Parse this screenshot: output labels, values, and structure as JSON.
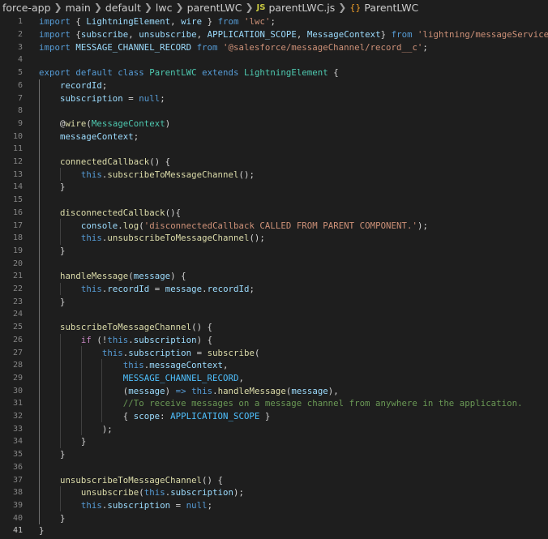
{
  "breadcrumb": {
    "items": [
      "force-app",
      "main",
      "default",
      "lwc",
      "parentLWC",
      "parentLWC.js",
      "ParentLWC"
    ],
    "js_badge": "JS",
    "class_badge": "{}"
  },
  "editor": {
    "active_line": 41,
    "lines": [
      {
        "n": "1",
        "t": [
          [
            "kw",
            "import "
          ],
          [
            "pn",
            "{ "
          ],
          [
            "var",
            "LightningElement"
          ],
          [
            "pn",
            ", "
          ],
          [
            "var",
            "wire"
          ],
          [
            "pn",
            " } "
          ],
          [
            "kw",
            "from "
          ],
          [
            "str",
            "'lwc'"
          ],
          [
            "pn",
            ";"
          ]
        ]
      },
      {
        "n": "2",
        "t": [
          [
            "kw",
            "import "
          ],
          [
            "pn",
            "{"
          ],
          [
            "var",
            "subscribe"
          ],
          [
            "pn",
            ", "
          ],
          [
            "var",
            "unsubscribe"
          ],
          [
            "pn",
            ", "
          ],
          [
            "var",
            "APPLICATION_SCOPE"
          ],
          [
            "pn",
            ", "
          ],
          [
            "var",
            "MessageContext"
          ],
          [
            "pn",
            "} "
          ],
          [
            "kw",
            "from "
          ],
          [
            "str",
            "'lightning/messageService'"
          ],
          [
            "pn",
            ";"
          ]
        ]
      },
      {
        "n": "3",
        "t": [
          [
            "kw",
            "import "
          ],
          [
            "var",
            "MESSAGE_CHANNEL_RECORD"
          ],
          [
            "kw",
            " from "
          ],
          [
            "str",
            "'@salesforce/messageChannel/record__c'"
          ],
          [
            "pn",
            ";"
          ]
        ]
      },
      {
        "n": "4",
        "t": []
      },
      {
        "n": "5",
        "t": [
          [
            "kw",
            "export "
          ],
          [
            "kw",
            "default "
          ],
          [
            "kw",
            "class "
          ],
          [
            "cls-t",
            "ParentLWC "
          ],
          [
            "kw",
            "extends "
          ],
          [
            "cls-t",
            "LightningElement "
          ],
          [
            "pn",
            "{"
          ]
        ]
      },
      {
        "n": "6",
        "t": [
          [
            "pn",
            "    "
          ],
          [
            "var",
            "recordId"
          ],
          [
            "pn",
            ";"
          ]
        ]
      },
      {
        "n": "7",
        "t": [
          [
            "pn",
            "    "
          ],
          [
            "var",
            "subscription"
          ],
          [
            "pn",
            " = "
          ],
          [
            "kw",
            "null"
          ],
          [
            "pn",
            ";"
          ]
        ]
      },
      {
        "n": "8",
        "t": []
      },
      {
        "n": "9",
        "t": [
          [
            "pn",
            "    @"
          ],
          [
            "fn",
            "wire"
          ],
          [
            "pn",
            "("
          ],
          [
            "cls-t",
            "MessageContext"
          ],
          [
            "pn",
            ")"
          ]
        ]
      },
      {
        "n": "10",
        "t": [
          [
            "pn",
            "    "
          ],
          [
            "var",
            "messageContext"
          ],
          [
            "pn",
            ";"
          ]
        ]
      },
      {
        "n": "11",
        "t": []
      },
      {
        "n": "12",
        "t": [
          [
            "pn",
            "    "
          ],
          [
            "fn",
            "connectedCallback"
          ],
          [
            "pn",
            "() {"
          ]
        ]
      },
      {
        "n": "13",
        "t": [
          [
            "pn",
            "        "
          ],
          [
            "kw",
            "this"
          ],
          [
            "pn",
            "."
          ],
          [
            "fn",
            "subscribeToMessageChannel"
          ],
          [
            "pn",
            "();"
          ]
        ]
      },
      {
        "n": "14",
        "t": [
          [
            "pn",
            "    }"
          ]
        ]
      },
      {
        "n": "15",
        "t": []
      },
      {
        "n": "16",
        "t": [
          [
            "pn",
            "    "
          ],
          [
            "fn",
            "disconnectedCallback"
          ],
          [
            "pn",
            "(){"
          ]
        ]
      },
      {
        "n": "17",
        "t": [
          [
            "pn",
            "        "
          ],
          [
            "var",
            "console"
          ],
          [
            "pn",
            "."
          ],
          [
            "fn",
            "log"
          ],
          [
            "pn",
            "("
          ],
          [
            "str",
            "'disconnectedCallback CALLED FROM PARENT COMPONENT.'"
          ],
          [
            "pn",
            ");"
          ]
        ]
      },
      {
        "n": "18",
        "t": [
          [
            "pn",
            "        "
          ],
          [
            "kw",
            "this"
          ],
          [
            "pn",
            "."
          ],
          [
            "fn",
            "unsubscribeToMessageChannel"
          ],
          [
            "pn",
            "();"
          ]
        ]
      },
      {
        "n": "19",
        "t": [
          [
            "pn",
            "    }"
          ]
        ]
      },
      {
        "n": "20",
        "t": []
      },
      {
        "n": "21",
        "t": [
          [
            "pn",
            "    "
          ],
          [
            "fn",
            "handleMessage"
          ],
          [
            "pn",
            "("
          ],
          [
            "var",
            "message"
          ],
          [
            "pn",
            ") {"
          ]
        ]
      },
      {
        "n": "22",
        "t": [
          [
            "pn",
            "        "
          ],
          [
            "kw",
            "this"
          ],
          [
            "pn",
            "."
          ],
          [
            "var",
            "recordId"
          ],
          [
            "pn",
            " = "
          ],
          [
            "var",
            "message"
          ],
          [
            "pn",
            "."
          ],
          [
            "var",
            "recordId"
          ],
          [
            "pn",
            ";"
          ]
        ]
      },
      {
        "n": "23",
        "t": [
          [
            "pn",
            "    }"
          ]
        ]
      },
      {
        "n": "24",
        "t": []
      },
      {
        "n": "25",
        "t": [
          [
            "pn",
            "    "
          ],
          [
            "fn",
            "subscribeToMessageChannel"
          ],
          [
            "pn",
            "() {"
          ]
        ]
      },
      {
        "n": "26",
        "t": [
          [
            "pn",
            "        "
          ],
          [
            "kw2",
            "if "
          ],
          [
            "pn",
            "(!"
          ],
          [
            "kw",
            "this"
          ],
          [
            "pn",
            "."
          ],
          [
            "var",
            "subscription"
          ],
          [
            "pn",
            ") {"
          ]
        ]
      },
      {
        "n": "27",
        "t": [
          [
            "pn",
            "            "
          ],
          [
            "kw",
            "this"
          ],
          [
            "pn",
            "."
          ],
          [
            "var",
            "subscription"
          ],
          [
            "pn",
            " = "
          ],
          [
            "fn",
            "subscribe"
          ],
          [
            "pn",
            "("
          ]
        ]
      },
      {
        "n": "28",
        "t": [
          [
            "pn",
            "                "
          ],
          [
            "kw",
            "this"
          ],
          [
            "pn",
            "."
          ],
          [
            "var",
            "messageContext"
          ],
          [
            "pn",
            ","
          ]
        ]
      },
      {
        "n": "29",
        "t": [
          [
            "pn",
            "                "
          ],
          [
            "const",
            "MESSAGE_CHANNEL_RECORD"
          ],
          [
            "pn",
            ","
          ]
        ]
      },
      {
        "n": "30",
        "t": [
          [
            "pn",
            "                ("
          ],
          [
            "var",
            "message"
          ],
          [
            "pn",
            ") "
          ],
          [
            "kw",
            "=>"
          ],
          [
            "pn",
            " "
          ],
          [
            "kw",
            "this"
          ],
          [
            "pn",
            "."
          ],
          [
            "fn",
            "handleMessage"
          ],
          [
            "pn",
            "("
          ],
          [
            "var",
            "message"
          ],
          [
            "pn",
            "),"
          ]
        ]
      },
      {
        "n": "31",
        "t": [
          [
            "pn",
            "                "
          ],
          [
            "cmt",
            "//To receive messages on a message channel from anywhere in the application."
          ]
        ]
      },
      {
        "n": "32",
        "t": [
          [
            "pn",
            "                { "
          ],
          [
            "var",
            "scope"
          ],
          [
            "pn",
            ": "
          ],
          [
            "const",
            "APPLICATION_SCOPE"
          ],
          [
            "pn",
            " }"
          ]
        ]
      },
      {
        "n": "33",
        "t": [
          [
            "pn",
            "            );"
          ]
        ]
      },
      {
        "n": "34",
        "t": [
          [
            "pn",
            "        }"
          ]
        ]
      },
      {
        "n": "35",
        "t": [
          [
            "pn",
            "    }"
          ]
        ]
      },
      {
        "n": "36",
        "t": []
      },
      {
        "n": "37",
        "t": [
          [
            "pn",
            "    "
          ],
          [
            "fn",
            "unsubscribeToMessageChannel"
          ],
          [
            "pn",
            "() {"
          ]
        ]
      },
      {
        "n": "38",
        "t": [
          [
            "pn",
            "        "
          ],
          [
            "fn",
            "unsubscribe"
          ],
          [
            "pn",
            "("
          ],
          [
            "kw",
            "this"
          ],
          [
            "pn",
            "."
          ],
          [
            "var",
            "subscription"
          ],
          [
            "pn",
            ");"
          ]
        ]
      },
      {
        "n": "39",
        "t": [
          [
            "pn",
            "        "
          ],
          [
            "kw",
            "this"
          ],
          [
            "pn",
            "."
          ],
          [
            "var",
            "subscription"
          ],
          [
            "pn",
            " = "
          ],
          [
            "kw",
            "null"
          ],
          [
            "pn",
            ";"
          ]
        ]
      },
      {
        "n": "40",
        "t": [
          [
            "pn",
            "    }"
          ]
        ]
      },
      {
        "n": "41",
        "t": [
          [
            "pn",
            "}"
          ]
        ]
      }
    ]
  }
}
